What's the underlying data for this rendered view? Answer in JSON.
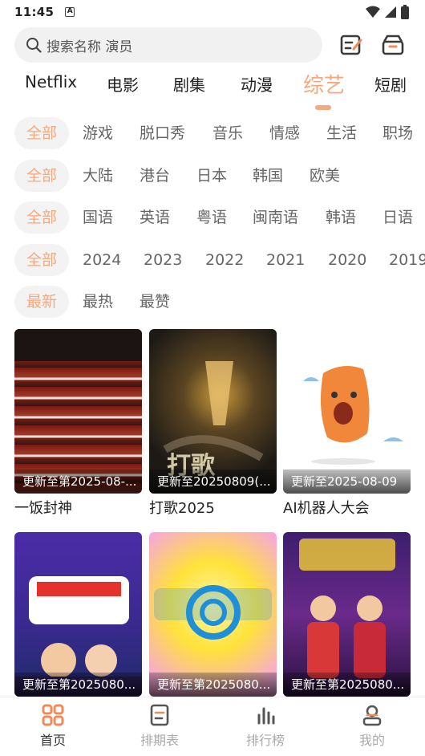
{
  "status": {
    "time": "11:45",
    "indicator": "A"
  },
  "search": {
    "placeholder": "搜索名称 演员"
  },
  "icons": {
    "search": "search-icon",
    "history": "edit-list-icon",
    "box": "archive-box-icon"
  },
  "top_tabs": [
    "Netflix",
    "电影",
    "剧集",
    "动漫",
    "综艺",
    "短剧"
  ],
  "active_top_tab": "综艺",
  "accent_color": "#f5a97f",
  "filters": {
    "genre": [
      "全部",
      "游戏",
      "脱口秀",
      "音乐",
      "情感",
      "生活",
      "职场"
    ],
    "region": [
      "全部",
      "大陆",
      "港台",
      "日本",
      "韩国",
      "欧美"
    ],
    "language": [
      "全部",
      "国语",
      "英语",
      "粤语",
      "闽南语",
      "韩语",
      "日语"
    ],
    "year": [
      "全部",
      "2024",
      "2023",
      "2022",
      "2021",
      "2020",
      "2019"
    ],
    "sort": [
      "最新",
      "最热",
      "最赞"
    ]
  },
  "cards": [
    {
      "title": "一饭封神",
      "update": "更新至第2025-08-..."
    },
    {
      "title": "打歌2025",
      "update": "更新至20250809(..."
    },
    {
      "title": "AI机器人大会",
      "update": "更新至2025-08-09"
    },
    {
      "title": "",
      "update": "更新至第2025080..."
    },
    {
      "title": "",
      "update": "更新至第2025080..."
    },
    {
      "title": "",
      "update": "更新至第2025080..."
    }
  ],
  "bottom_nav": [
    {
      "label": "首页",
      "icon": "home-grid-icon",
      "active": true
    },
    {
      "label": "排期表",
      "icon": "schedule-icon",
      "active": false
    },
    {
      "label": "排行榜",
      "icon": "ranking-icon",
      "active": false
    },
    {
      "label": "我的",
      "icon": "profile-icon",
      "active": false
    }
  ]
}
